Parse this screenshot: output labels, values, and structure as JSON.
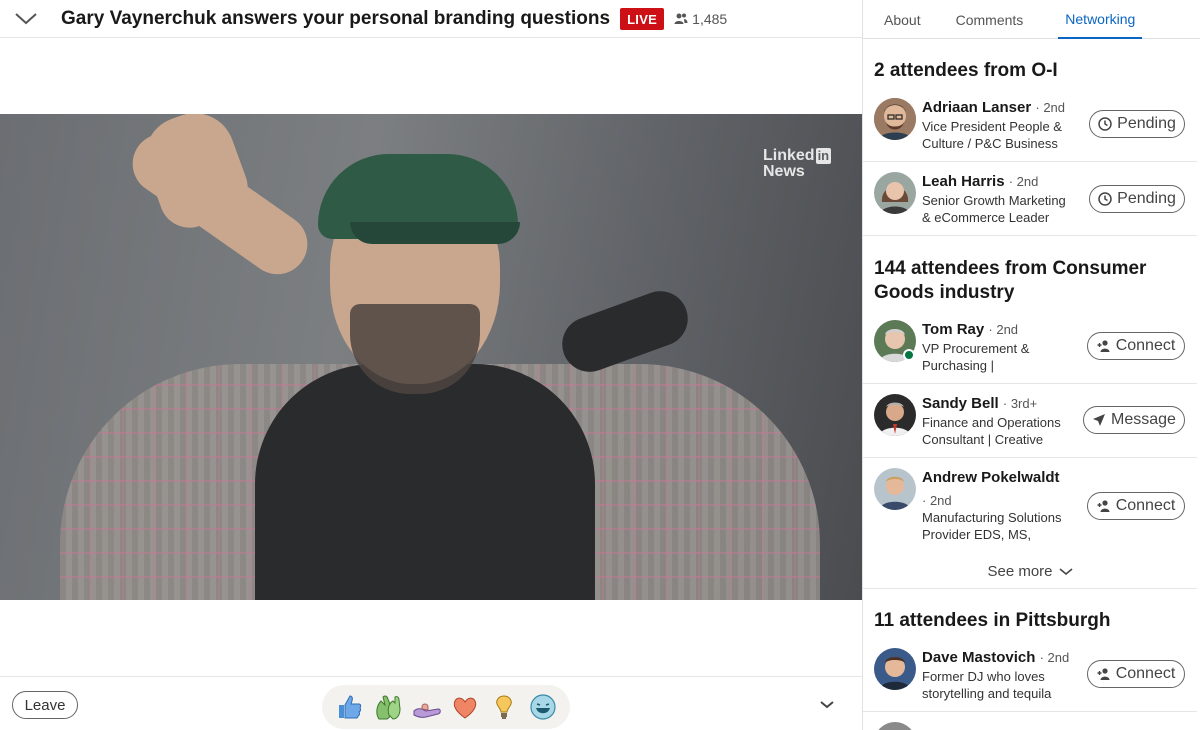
{
  "header": {
    "title": "Gary Vaynerchuk answers your personal branding questions",
    "live_label": "LIVE",
    "viewer_count": "1,485"
  },
  "video": {
    "watermark_line1": "Linked",
    "watermark_in": "in",
    "watermark_line2": "News"
  },
  "bottom": {
    "leave_label": "Leave",
    "reactions": [
      "like-icon",
      "celebrate-icon",
      "support-icon",
      "love-icon",
      "insightful-icon",
      "funny-icon"
    ]
  },
  "tabs": [
    {
      "label": "About",
      "active": false
    },
    {
      "label": "Comments",
      "active": false
    },
    {
      "label": "Networking",
      "active": true
    }
  ],
  "sections": [
    {
      "title": "2 attendees from O-I",
      "people": [
        {
          "name": "Adriaan Lanser",
          "degree": "· 2nd",
          "desc": "Vice President People & Culture / P&C Business Partner",
          "action": "Pending"
        },
        {
          "name": "Leah Harris",
          "degree": "· 2nd",
          "desc": "Senior Growth Marketing & eCommerce Leader",
          "action": "Pending"
        }
      ]
    },
    {
      "title": "144 attendees from Consumer Goods industry",
      "people": [
        {
          "name": "Tom Ray",
          "degree": "· 2nd",
          "desc": "VP Procurement & Purchasing | Procurement Strategy",
          "action": "Connect"
        },
        {
          "name": "Sandy Bell",
          "degree": "· 3rd+",
          "desc": "Finance and Operations Consultant | Creative Problem Solver",
          "action": "Message"
        },
        {
          "name": "Andrew Pokelwaldt",
          "degree": "· 2nd",
          "desc": "Manufacturing Solutions Provider EDS, MS, SPHR, SHRM-SCP",
          "action": "Connect"
        }
      ],
      "see_more": "See more"
    },
    {
      "title": "11 attendees in Pittsburgh",
      "people": [
        {
          "name": "Dave Mastovich",
          "degree": "· 2nd",
          "desc": "Former DJ who loves storytelling and tequila",
          "action": "Connect"
        }
      ]
    }
  ]
}
